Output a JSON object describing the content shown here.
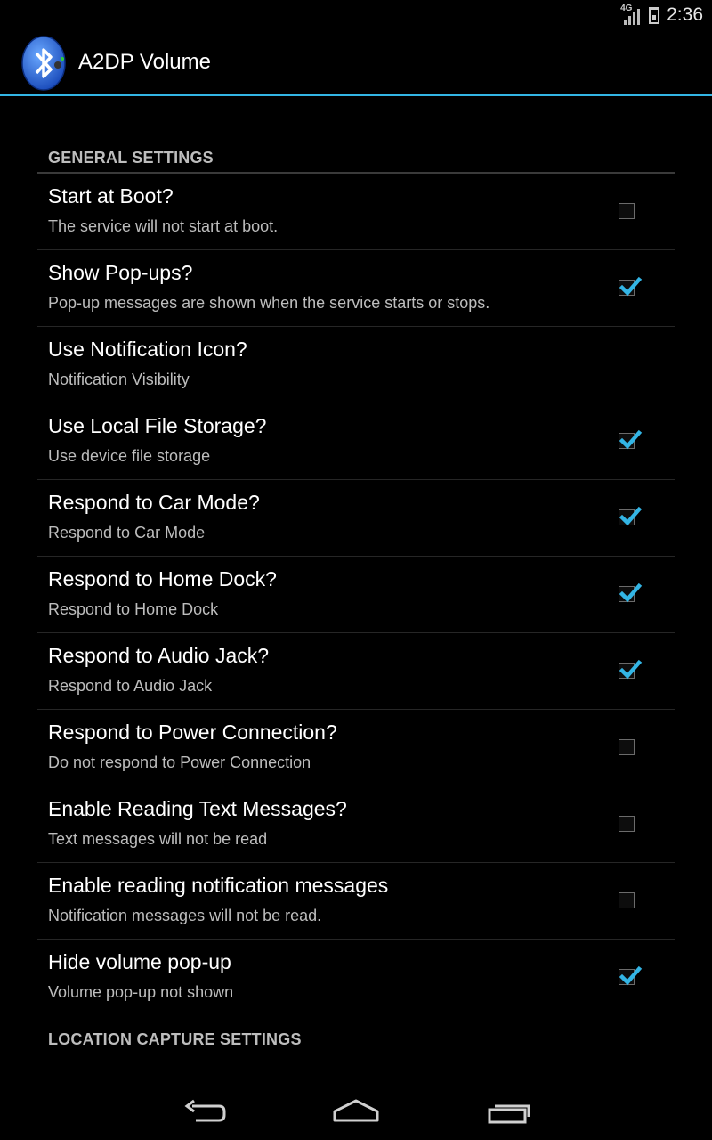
{
  "status_bar": {
    "network_label": "4G",
    "time": "2:36"
  },
  "app": {
    "title": "A2DP Volume",
    "icon": "bluetooth-icon"
  },
  "accent_color": "#33b5e5",
  "sections": {
    "general": {
      "label": "GENERAL SETTINGS"
    },
    "location": {
      "label": "LOCATION CAPTURE SETTINGS"
    }
  },
  "settings": [
    {
      "title": "Start at Boot?",
      "summary": "The service will not start at boot.",
      "checkbox": true,
      "checked": false
    },
    {
      "title": "Show Pop-ups?",
      "summary": "Pop-up messages are shown when the service starts or stops.",
      "checkbox": true,
      "checked": true
    },
    {
      "title": "Use Notification Icon?",
      "summary": "Notification Visibility",
      "checkbox": false,
      "checked": false
    },
    {
      "title": "Use Local File Storage?",
      "summary": "Use device file storage",
      "checkbox": true,
      "checked": true
    },
    {
      "title": "Respond to Car Mode?",
      "summary": "Respond to Car Mode",
      "checkbox": true,
      "checked": true
    },
    {
      "title": "Respond to Home Dock?",
      "summary": "Respond to Home Dock",
      "checkbox": true,
      "checked": true
    },
    {
      "title": "Respond to Audio Jack?",
      "summary": "Respond to Audio Jack",
      "checkbox": true,
      "checked": true
    },
    {
      "title": "Respond to Power Connection?",
      "summary": "Do not respond to Power Connection",
      "checkbox": true,
      "checked": false
    },
    {
      "title": "Enable Reading Text Messages?",
      "summary": "Text messages will not be read",
      "checkbox": true,
      "checked": false
    },
    {
      "title": "Enable reading notification messages",
      "summary": "Notification messages will not be read.",
      "checkbox": true,
      "checked": false
    },
    {
      "title": "Hide volume pop-up",
      "summary": "Volume pop-up not shown",
      "checkbox": true,
      "checked": true
    }
  ],
  "navigation": {
    "back": "back-icon",
    "home": "home-icon",
    "recents": "recents-icon"
  }
}
